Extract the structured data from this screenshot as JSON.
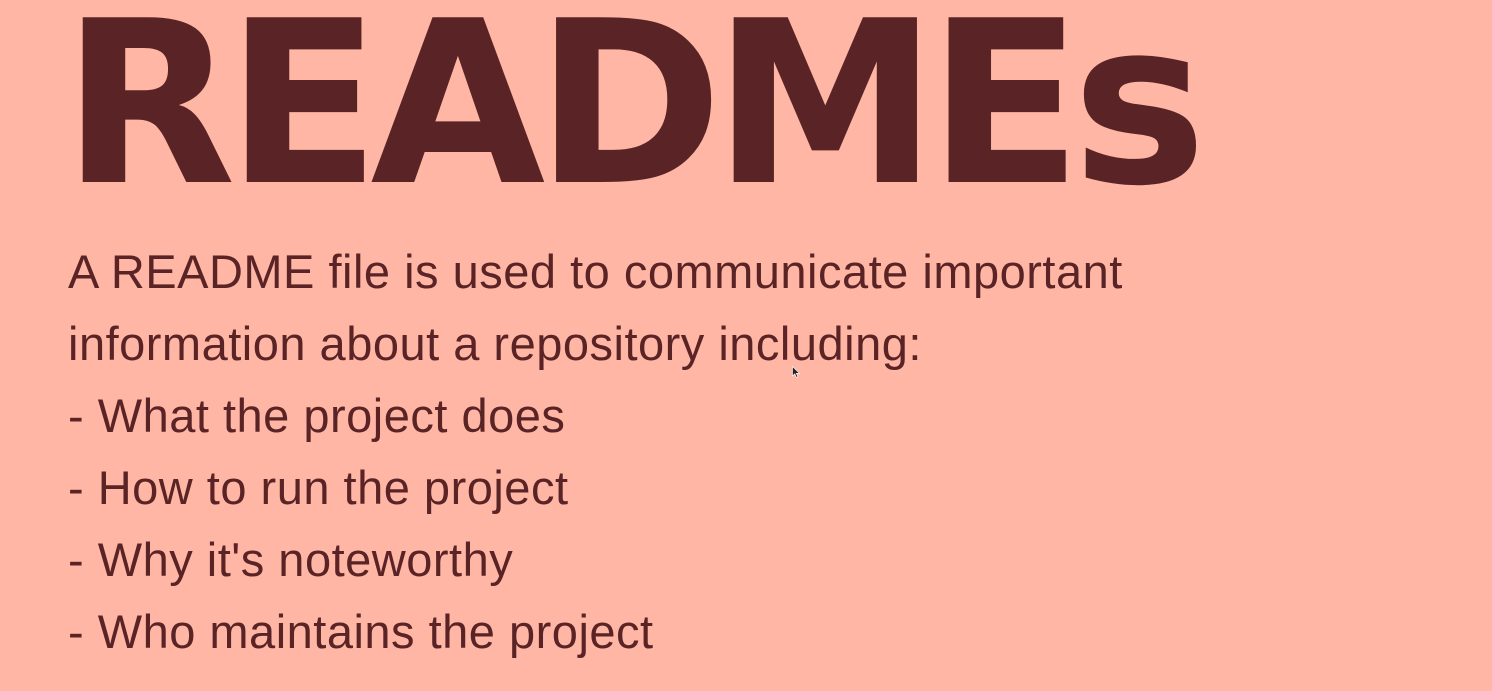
{
  "slide": {
    "title": "READMEs",
    "intro_line_1": "A README file is used to communicate important",
    "intro_line_2": "information about a repository including:",
    "bullets": [
      "- What the project does",
      "- How to run the project",
      "- Why it's noteworthy",
      "- Who maintains the project"
    ]
  },
  "colors": {
    "background": "#ffb6a4",
    "text": "#5a2426"
  },
  "icons": {
    "cursor": "mouse-pointer-icon"
  }
}
